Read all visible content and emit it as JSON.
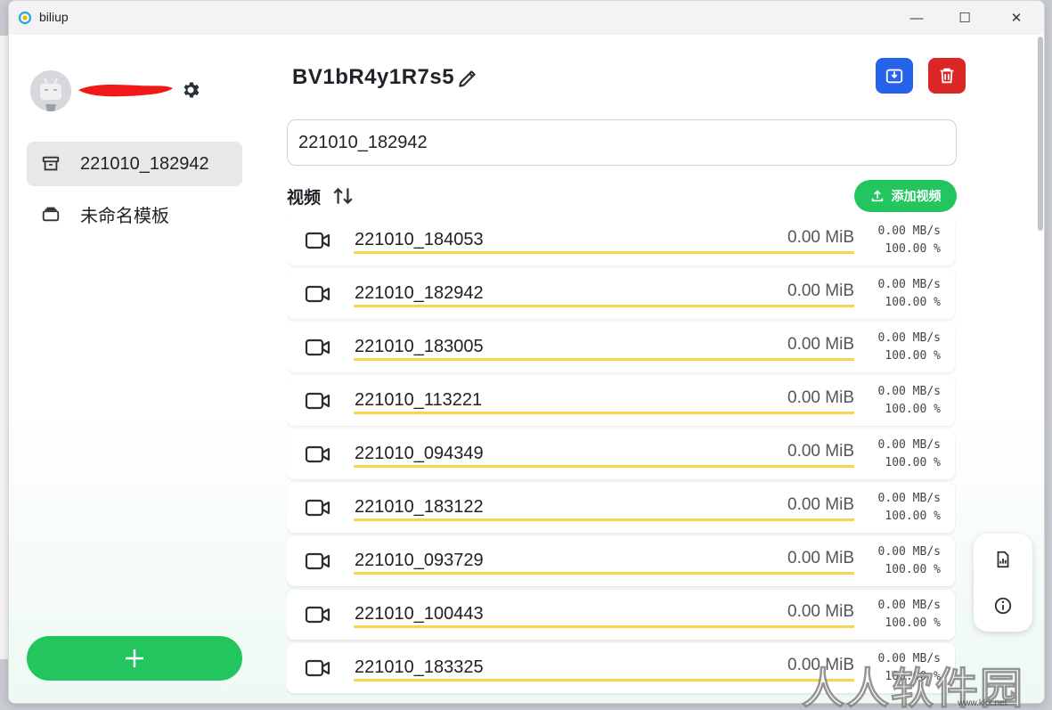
{
  "window": {
    "title": "biliup",
    "minimize": "—",
    "maximize": "☐",
    "close": "✕"
  },
  "sidebar": {
    "items": [
      {
        "label": "221010_182942",
        "icon": "archive-icon",
        "active": true
      },
      {
        "label": "未命名模板",
        "icon": "stack-icon",
        "active": false
      }
    ],
    "add_label": "+"
  },
  "main": {
    "title": "BV1bR4y1R7s5",
    "input_value": "221010_182942",
    "videos_header": "视频",
    "add_video_label": "添加视频",
    "videos": [
      {
        "name": "221010_184053",
        "size": "0.00 MiB",
        "speed": "0.00 MB/s",
        "percent": "100.00 %",
        "progress": 1.0
      },
      {
        "name": "221010_182942",
        "size": "0.00 MiB",
        "speed": "0.00 MB/s",
        "percent": "100.00 %",
        "progress": 1.0
      },
      {
        "name": "221010_183005",
        "size": "0.00 MiB",
        "speed": "0.00 MB/s",
        "percent": "100.00 %",
        "progress": 1.0
      },
      {
        "name": "221010_113221",
        "size": "0.00 MiB",
        "speed": "0.00 MB/s",
        "percent": "100.00 %",
        "progress": 1.0
      },
      {
        "name": "221010_094349",
        "size": "0.00 MiB",
        "speed": "0.00 MB/s",
        "percent": "100.00 %",
        "progress": 1.0
      },
      {
        "name": "221010_183122",
        "size": "0.00 MiB",
        "speed": "0.00 MB/s",
        "percent": "100.00 %",
        "progress": 1.0
      },
      {
        "name": "221010_093729",
        "size": "0.00 MiB",
        "speed": "0.00 MB/s",
        "percent": "100.00 %",
        "progress": 1.0
      },
      {
        "name": "221010_100443",
        "size": "0.00 MiB",
        "speed": "0.00 MB/s",
        "percent": "100.00 %",
        "progress": 1.0
      },
      {
        "name": "221010_183325",
        "size": "0.00 MiB",
        "speed": "0.00 MB/s",
        "percent": "100.00 %",
        "progress": 1.0
      }
    ]
  },
  "colors": {
    "green": "#22c55e",
    "blue": "#2563eb",
    "red": "#dc2626",
    "progress": "#fcd34d"
  },
  "watermark": {
    "text": "人人软件园",
    "sub": "www.kkx.net"
  }
}
